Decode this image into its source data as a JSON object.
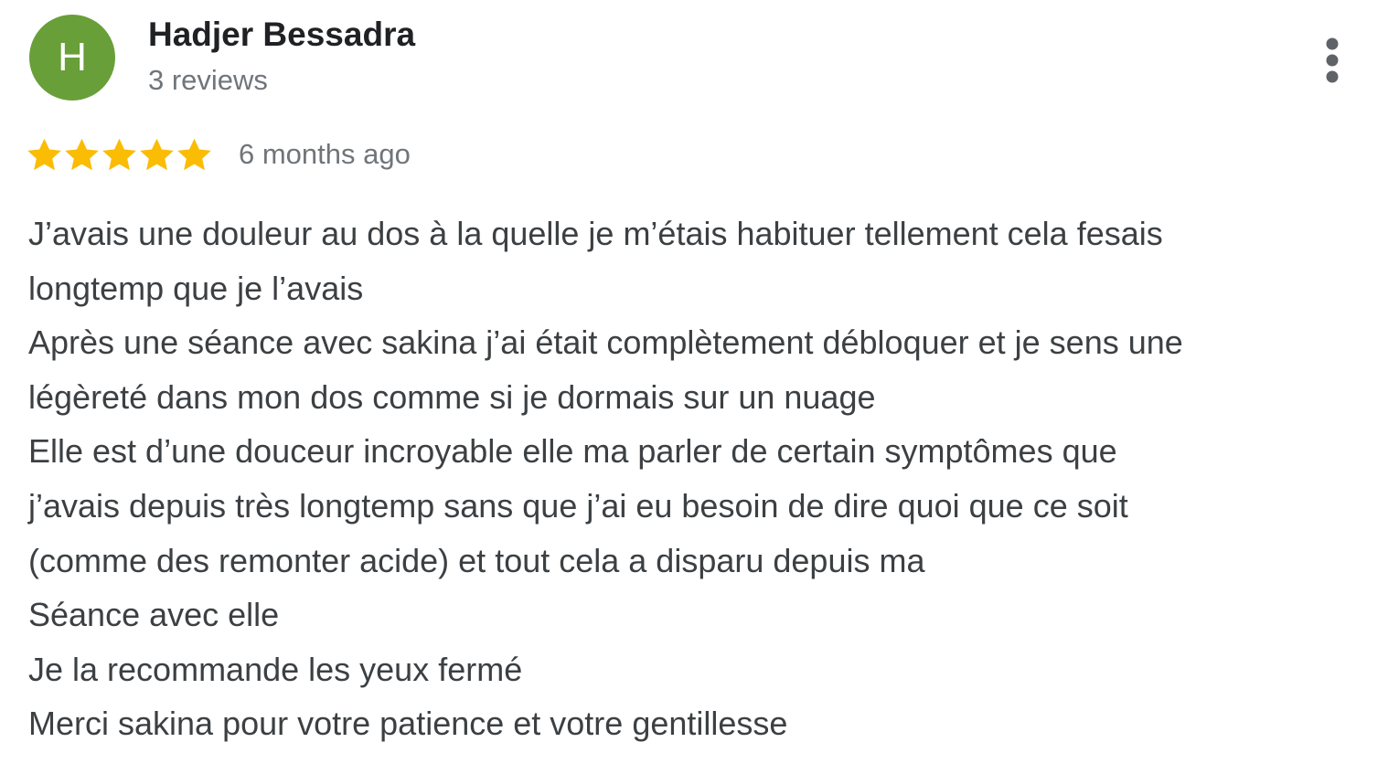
{
  "reviewer": {
    "initial": "H",
    "name": "Hadjer Bessadra",
    "review_count": "3 reviews",
    "avatar_color": "#689f38"
  },
  "menu": {
    "icon": "more-vertical-icon"
  },
  "rating": {
    "stars": 5,
    "max_stars": 5,
    "star_color": "#fbbc04",
    "date": "6 months ago"
  },
  "review": {
    "lines": [
      "J’avais une douleur au dos à la quelle je m’étais habituer tellement cela fesais",
      "longtemp que je l’avais",
      "Après une séance avec sakina j’ai était complètement débloquer et je sens une",
      "légèreté dans mon dos comme si je dormais sur un nuage",
      "Elle est d’une douceur incroyable elle ma parler de certain symptômes que",
      "j’avais depuis très longtemp sans que j’ai eu besoin de dire quoi que ce soit",
      "(comme des remonter acide) et tout cela a disparu depuis ma",
      "Séance avec elle",
      "Je la recommande les yeux fermé",
      "Merci sakina pour votre patience et votre gentillesse"
    ]
  }
}
